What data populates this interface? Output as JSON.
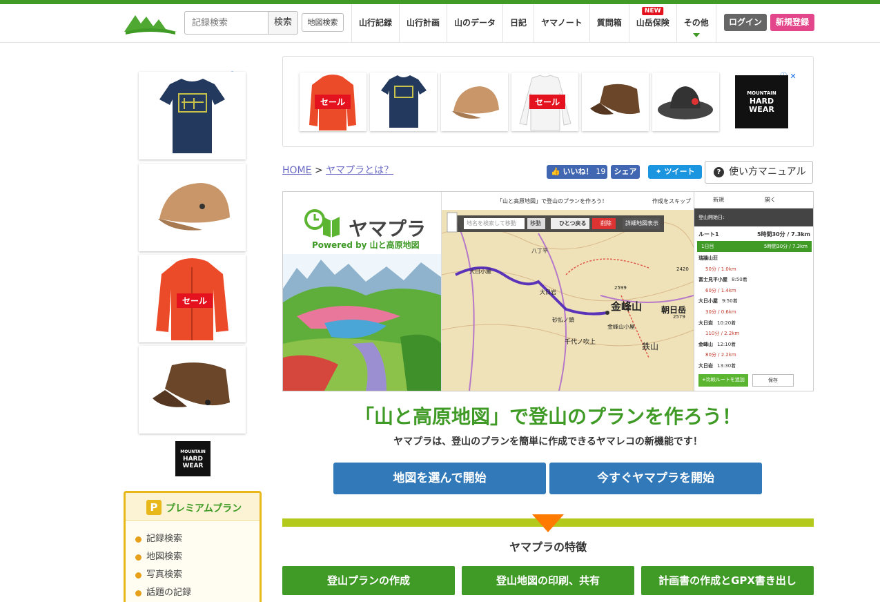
{
  "header": {
    "search_placeholder": "記録検索",
    "search_button": "検索",
    "map_search_button": "地図検索",
    "nav": [
      {
        "label": "山行記録"
      },
      {
        "label": "山行計画"
      },
      {
        "label": "山のデータ"
      },
      {
        "label": "日記"
      },
      {
        "label": "ヤマノート"
      },
      {
        "label": "質問箱"
      },
      {
        "label": "山岳保険",
        "badge": "NEW"
      },
      {
        "label": "その他"
      }
    ],
    "login": "ログイン",
    "register": "新規登録"
  },
  "ads": {
    "sale": "セール",
    "brand_line1": "MOUNTAIN",
    "brand_line2": "HARD",
    "brand_line3": "WEAR"
  },
  "premium": {
    "icon_letter": "P",
    "title": "プレミアムプラン",
    "items": [
      "記録検索",
      "地図検索",
      "写真検索",
      "話題の記録"
    ]
  },
  "breadcrumb": {
    "home": "HOME",
    "separator": ">",
    "current": "ヤマプラとは？"
  },
  "social": {
    "like": "いいね！",
    "like_count": "19",
    "share": "シェア",
    "tweet": "ツイート"
  },
  "manual": "使い方マニュアル",
  "hero": {
    "brand": "ヤマプラ",
    "powered": "Powered by 山と高原地図",
    "map_header": "「山と高原地図」で登山のプランを作ろう！",
    "skip": "作成をスキップ",
    "map_search_placeholder": "地名を検索して移動",
    "move": "移動",
    "undo": "ひとつ戻る",
    "delete": "削除",
    "detail_map": "詳細地図表示",
    "map_labels": {
      "peak": "金峰山",
      "asahi": "朝日岳",
      "tetsu": "鉄山",
      "chiyo": "千代ノ吹上",
      "odai": "大日岩",
      "sunaharai": "砂払ノ頭",
      "hut": "金峰山小屋",
      "yahoko": "八丁平",
      "odaikoya": "大日小屋",
      "elev1": "2599",
      "elev2": "2579",
      "elev3": "2420"
    },
    "panel": {
      "tab_new": "新規",
      "tab_open": "開く",
      "start_label": "登山開始日:",
      "route": "ルート1",
      "total": "5時間30分 / 7.3km",
      "day": "1日目",
      "day_total": "5時間30分 / 7.3km",
      "stops": [
        {
          "name": "瑞牆山荘",
          "time": ""
        },
        {
          "name": "富士見平小屋",
          "time": "8:50着"
        },
        {
          "name": "大日小屋",
          "time": "9:50着"
        },
        {
          "name": "大日岩",
          "time": "10:20着"
        },
        {
          "name": "金峰山",
          "time": "12:10着"
        },
        {
          "name": "大日岩",
          "time": "13:30着"
        }
      ],
      "legs": [
        "50分 / 1.0km",
        "60分 / 1.4km",
        "30分 / 0.6km",
        "110分 / 2.2km",
        "80分 / 2.2km"
      ],
      "add_route": "+比較ルートを追加",
      "save": "保存"
    }
  },
  "main": {
    "title": "「山と高原地図」で登山のプランを作ろう！",
    "subtitle": "ヤマプラは、登山のプランを簡単に作成できるヤマレコの新機能です！",
    "btn_map": "地図を選んで開始",
    "btn_now": "今すぐヤマプラを開始"
  },
  "features": {
    "title": "ヤマプラの特徴",
    "items": [
      "登山プランの作成",
      "登山地図の印刷、共有",
      "計画書の作成とGPX書き出し"
    ]
  },
  "colors": {
    "brand_green": "#3f9a26",
    "cta_blue": "#3179b9",
    "register_pink": "#e4468b",
    "accent_orange": "#ff7a00"
  }
}
